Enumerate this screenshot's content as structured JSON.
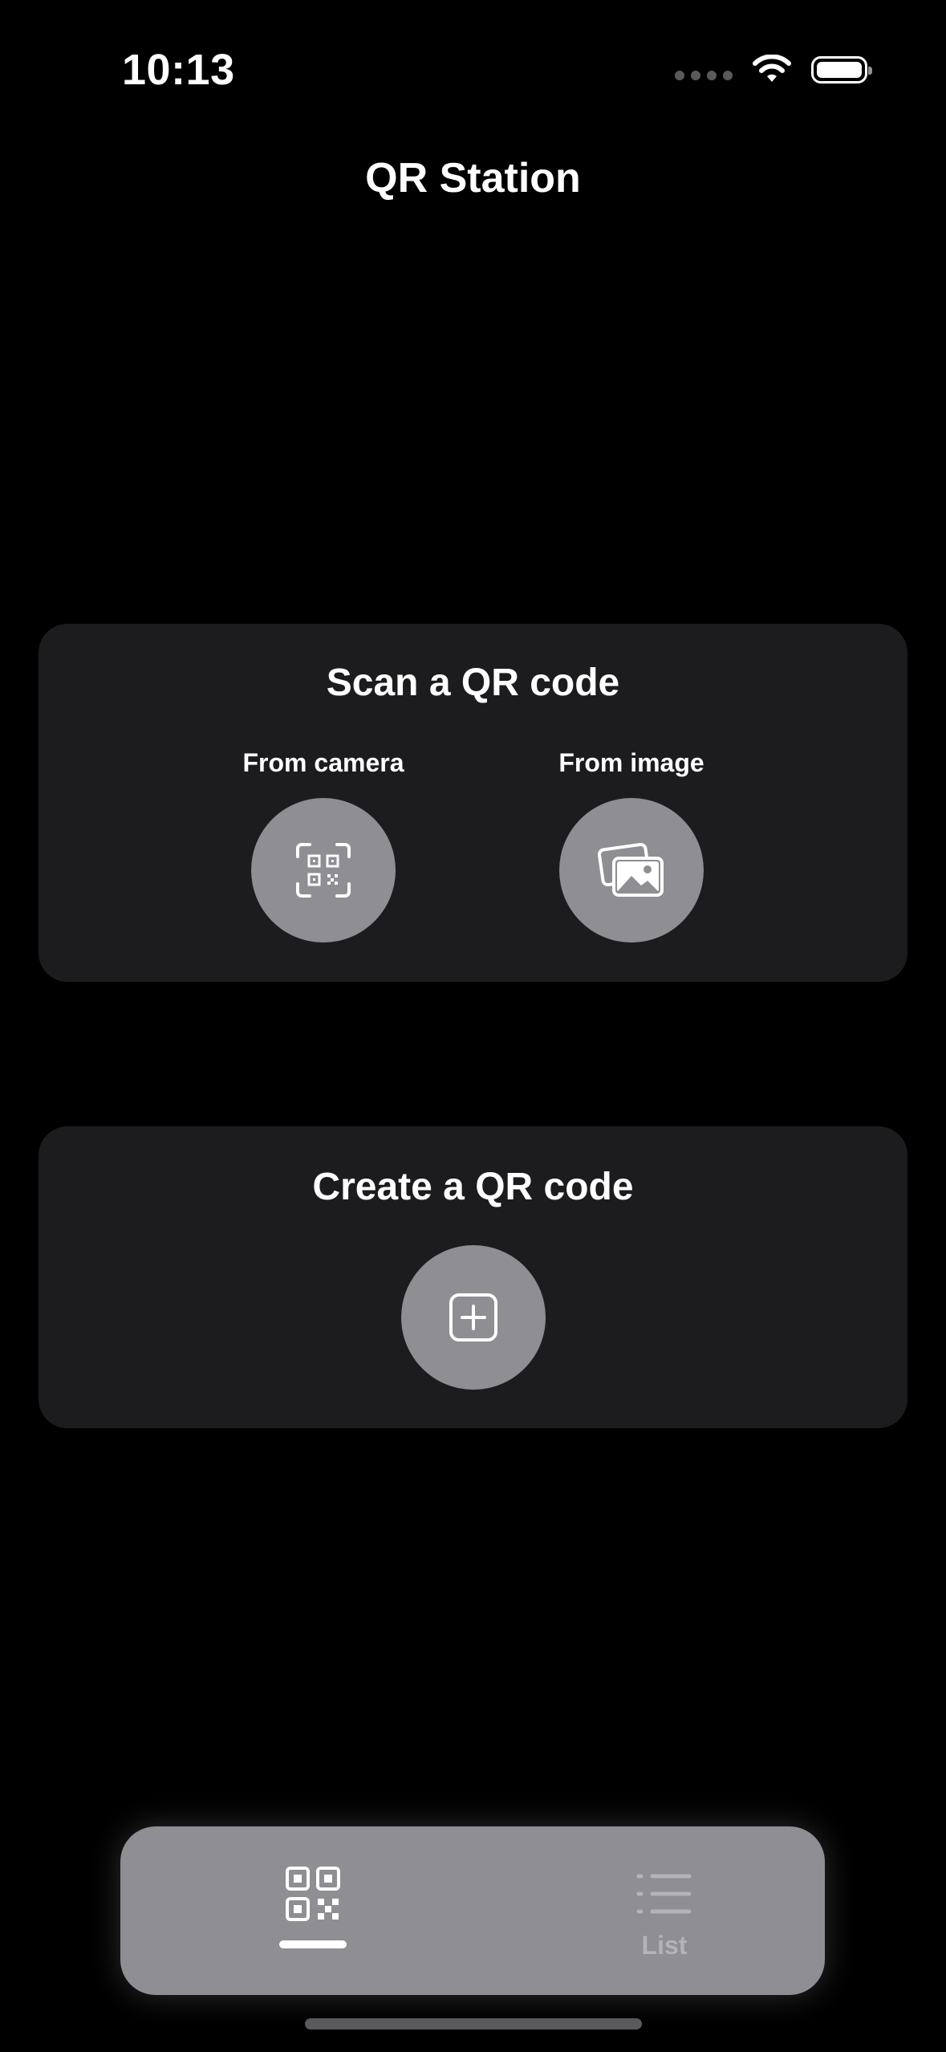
{
  "status_bar": {
    "time": "10:13",
    "icons": [
      "cellular-signal-icon",
      "wifi-icon",
      "battery-icon"
    ]
  },
  "nav": {
    "title": "QR Station"
  },
  "scan_card": {
    "title": "Scan a QR code",
    "options": [
      {
        "label": "From camera",
        "icon": "qr-scan-icon"
      },
      {
        "label": "From image",
        "icon": "photos-icon"
      }
    ]
  },
  "create_card": {
    "title": "Create a QR code",
    "icon": "plus-square-icon"
  },
  "tabbar": {
    "tabs": [
      {
        "name": "qr",
        "label": "",
        "icon": "qr-code-icon",
        "selected": true
      },
      {
        "name": "list",
        "label": "List",
        "icon": "list-icon",
        "selected": false
      }
    ]
  },
  "colors": {
    "background": "#000000",
    "card": "#1c1c1e",
    "button": "#8e8e93",
    "text": "#ffffff",
    "tab_inactive_text": "#b3b3b8"
  }
}
